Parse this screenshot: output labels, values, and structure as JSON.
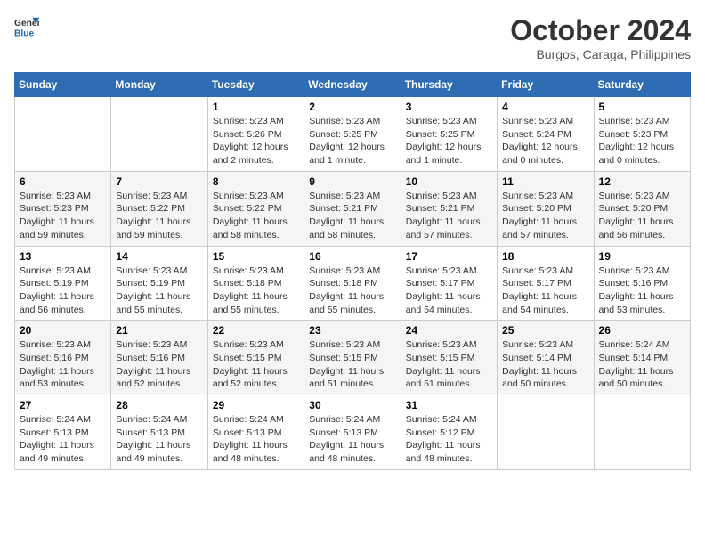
{
  "header": {
    "logo_line1": "General",
    "logo_line2": "Blue",
    "month_title": "October 2024",
    "location": "Burgos, Caraga, Philippines"
  },
  "weekdays": [
    "Sunday",
    "Monday",
    "Tuesday",
    "Wednesday",
    "Thursday",
    "Friday",
    "Saturday"
  ],
  "weeks": [
    [
      {
        "day": "",
        "sunrise": "",
        "sunset": "",
        "daylight": ""
      },
      {
        "day": "",
        "sunrise": "",
        "sunset": "",
        "daylight": ""
      },
      {
        "day": "1",
        "sunrise": "Sunrise: 5:23 AM",
        "sunset": "Sunset: 5:26 PM",
        "daylight": "Daylight: 12 hours and 2 minutes."
      },
      {
        "day": "2",
        "sunrise": "Sunrise: 5:23 AM",
        "sunset": "Sunset: 5:25 PM",
        "daylight": "Daylight: 12 hours and 1 minute."
      },
      {
        "day": "3",
        "sunrise": "Sunrise: 5:23 AM",
        "sunset": "Sunset: 5:25 PM",
        "daylight": "Daylight: 12 hours and 1 minute."
      },
      {
        "day": "4",
        "sunrise": "Sunrise: 5:23 AM",
        "sunset": "Sunset: 5:24 PM",
        "daylight": "Daylight: 12 hours and 0 minutes."
      },
      {
        "day": "5",
        "sunrise": "Sunrise: 5:23 AM",
        "sunset": "Sunset: 5:23 PM",
        "daylight": "Daylight: 12 hours and 0 minutes."
      }
    ],
    [
      {
        "day": "6",
        "sunrise": "Sunrise: 5:23 AM",
        "sunset": "Sunset: 5:23 PM",
        "daylight": "Daylight: 11 hours and 59 minutes."
      },
      {
        "day": "7",
        "sunrise": "Sunrise: 5:23 AM",
        "sunset": "Sunset: 5:22 PM",
        "daylight": "Daylight: 11 hours and 59 minutes."
      },
      {
        "day": "8",
        "sunrise": "Sunrise: 5:23 AM",
        "sunset": "Sunset: 5:22 PM",
        "daylight": "Daylight: 11 hours and 58 minutes."
      },
      {
        "day": "9",
        "sunrise": "Sunrise: 5:23 AM",
        "sunset": "Sunset: 5:21 PM",
        "daylight": "Daylight: 11 hours and 58 minutes."
      },
      {
        "day": "10",
        "sunrise": "Sunrise: 5:23 AM",
        "sunset": "Sunset: 5:21 PM",
        "daylight": "Daylight: 11 hours and 57 minutes."
      },
      {
        "day": "11",
        "sunrise": "Sunrise: 5:23 AM",
        "sunset": "Sunset: 5:20 PM",
        "daylight": "Daylight: 11 hours and 57 minutes."
      },
      {
        "day": "12",
        "sunrise": "Sunrise: 5:23 AM",
        "sunset": "Sunset: 5:20 PM",
        "daylight": "Daylight: 11 hours and 56 minutes."
      }
    ],
    [
      {
        "day": "13",
        "sunrise": "Sunrise: 5:23 AM",
        "sunset": "Sunset: 5:19 PM",
        "daylight": "Daylight: 11 hours and 56 minutes."
      },
      {
        "day": "14",
        "sunrise": "Sunrise: 5:23 AM",
        "sunset": "Sunset: 5:19 PM",
        "daylight": "Daylight: 11 hours and 55 minutes."
      },
      {
        "day": "15",
        "sunrise": "Sunrise: 5:23 AM",
        "sunset": "Sunset: 5:18 PM",
        "daylight": "Daylight: 11 hours and 55 minutes."
      },
      {
        "day": "16",
        "sunrise": "Sunrise: 5:23 AM",
        "sunset": "Sunset: 5:18 PM",
        "daylight": "Daylight: 11 hours and 55 minutes."
      },
      {
        "day": "17",
        "sunrise": "Sunrise: 5:23 AM",
        "sunset": "Sunset: 5:17 PM",
        "daylight": "Daylight: 11 hours and 54 minutes."
      },
      {
        "day": "18",
        "sunrise": "Sunrise: 5:23 AM",
        "sunset": "Sunset: 5:17 PM",
        "daylight": "Daylight: 11 hours and 54 minutes."
      },
      {
        "day": "19",
        "sunrise": "Sunrise: 5:23 AM",
        "sunset": "Sunset: 5:16 PM",
        "daylight": "Daylight: 11 hours and 53 minutes."
      }
    ],
    [
      {
        "day": "20",
        "sunrise": "Sunrise: 5:23 AM",
        "sunset": "Sunset: 5:16 PM",
        "daylight": "Daylight: 11 hours and 53 minutes."
      },
      {
        "day": "21",
        "sunrise": "Sunrise: 5:23 AM",
        "sunset": "Sunset: 5:16 PM",
        "daylight": "Daylight: 11 hours and 52 minutes."
      },
      {
        "day": "22",
        "sunrise": "Sunrise: 5:23 AM",
        "sunset": "Sunset: 5:15 PM",
        "daylight": "Daylight: 11 hours and 52 minutes."
      },
      {
        "day": "23",
        "sunrise": "Sunrise: 5:23 AM",
        "sunset": "Sunset: 5:15 PM",
        "daylight": "Daylight: 11 hours and 51 minutes."
      },
      {
        "day": "24",
        "sunrise": "Sunrise: 5:23 AM",
        "sunset": "Sunset: 5:15 PM",
        "daylight": "Daylight: 11 hours and 51 minutes."
      },
      {
        "day": "25",
        "sunrise": "Sunrise: 5:23 AM",
        "sunset": "Sunset: 5:14 PM",
        "daylight": "Daylight: 11 hours and 50 minutes."
      },
      {
        "day": "26",
        "sunrise": "Sunrise: 5:24 AM",
        "sunset": "Sunset: 5:14 PM",
        "daylight": "Daylight: 11 hours and 50 minutes."
      }
    ],
    [
      {
        "day": "27",
        "sunrise": "Sunrise: 5:24 AM",
        "sunset": "Sunset: 5:13 PM",
        "daylight": "Daylight: 11 hours and 49 minutes."
      },
      {
        "day": "28",
        "sunrise": "Sunrise: 5:24 AM",
        "sunset": "Sunset: 5:13 PM",
        "daylight": "Daylight: 11 hours and 49 minutes."
      },
      {
        "day": "29",
        "sunrise": "Sunrise: 5:24 AM",
        "sunset": "Sunset: 5:13 PM",
        "daylight": "Daylight: 11 hours and 48 minutes."
      },
      {
        "day": "30",
        "sunrise": "Sunrise: 5:24 AM",
        "sunset": "Sunset: 5:13 PM",
        "daylight": "Daylight: 11 hours and 48 minutes."
      },
      {
        "day": "31",
        "sunrise": "Sunrise: 5:24 AM",
        "sunset": "Sunset: 5:12 PM",
        "daylight": "Daylight: 11 hours and 48 minutes."
      },
      {
        "day": "",
        "sunrise": "",
        "sunset": "",
        "daylight": ""
      },
      {
        "day": "",
        "sunrise": "",
        "sunset": "",
        "daylight": ""
      }
    ]
  ]
}
